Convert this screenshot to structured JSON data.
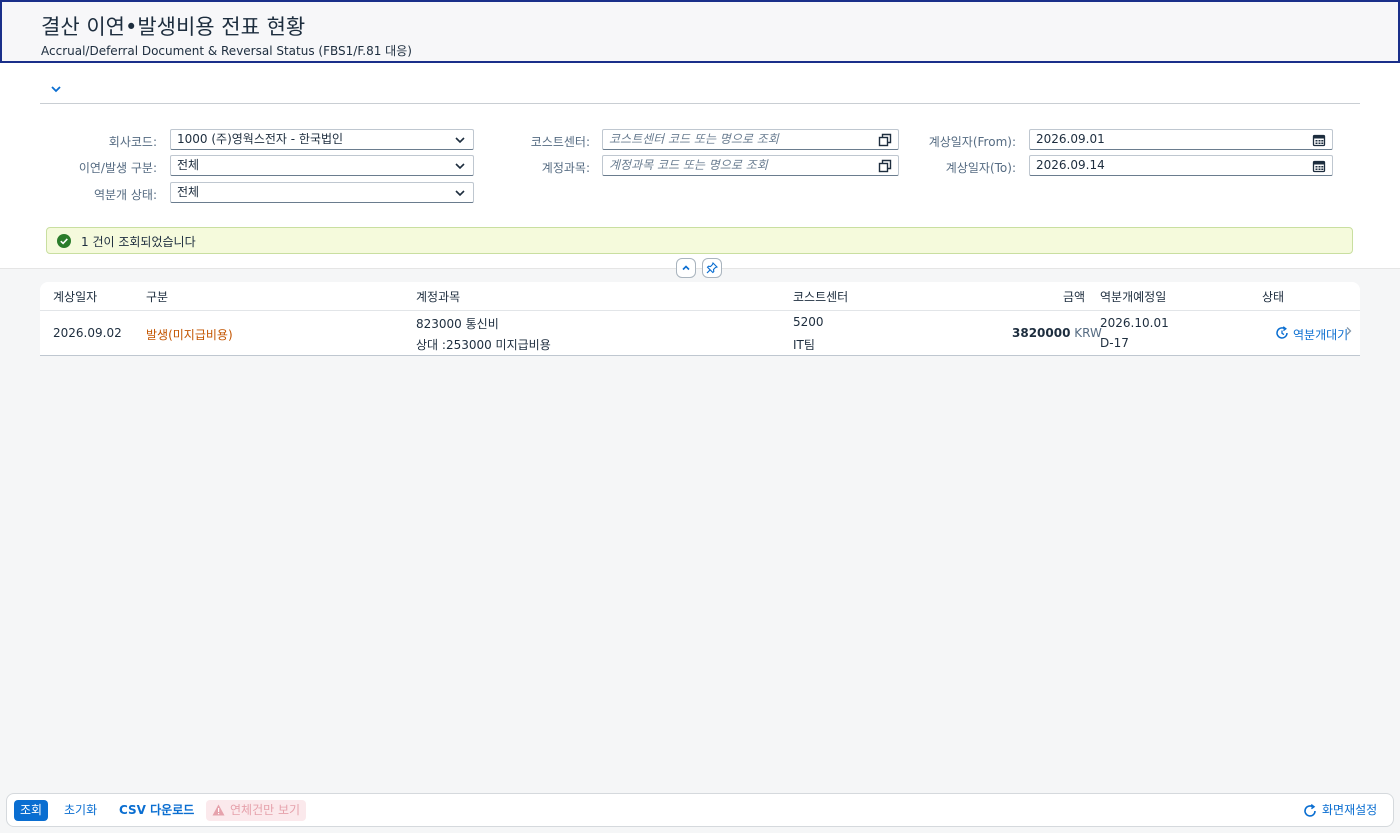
{
  "header": {
    "title": "결산 이연•발생비용 전표 현황",
    "subtitle": "Accrual/Deferral Document & Reversal Status (FBS1/F.81 대응)"
  },
  "filters": {
    "company_code": {
      "label": "회사코드:",
      "value": "1000 (주)영웍스전자 - 한국법인"
    },
    "type": {
      "label": "이연/발생 구분:",
      "value": "전체"
    },
    "reversal_status": {
      "label": "역분개 상태:",
      "value": "전체"
    },
    "cost_center": {
      "label": "코스트센터:",
      "placeholder": "코스트센터 코드 또는 명으로 조회"
    },
    "gl_account": {
      "label": "계정과목:",
      "placeholder": "계정과목 코드 또는 명으로 조회"
    },
    "date_from": {
      "label": "계상일자(From):",
      "value": "2026.09.01"
    },
    "date_to": {
      "label": "계상일자(To):",
      "value": "2026.09.14"
    }
  },
  "message": {
    "text": "1 건이 조회되었습니다"
  },
  "table": {
    "columns": {
      "date": "계상일자",
      "type": "구분",
      "account": "계정과목",
      "cost_center": "코스트센터",
      "amount": "금액",
      "reversal_date": "역분개예정일",
      "status": "상태"
    },
    "rows": [
      {
        "date": "2026.09.02",
        "type": "발생(미지급비용)",
        "account": "823000 통신비",
        "offset_account": "상대 :253000 미지급비용",
        "cost_center_code": "5200",
        "cost_center_name": "IT팀",
        "amount": "3820000",
        "currency": "KRW",
        "reversal_date": "2026.10.01",
        "d_day": "D-17",
        "status": "역분개대기"
      }
    ]
  },
  "footer": {
    "search": "조회",
    "reset": "초기화",
    "csv": "CSV 다운로드",
    "overdue_only": "연체건만 보기",
    "screen_settings": "화면재설정"
  },
  "colors": {
    "brand_blue": "#0a6ed1",
    "accrual_type": "#c35500",
    "success": "#2b7c2b",
    "header_border": "#1a2f8a"
  }
}
